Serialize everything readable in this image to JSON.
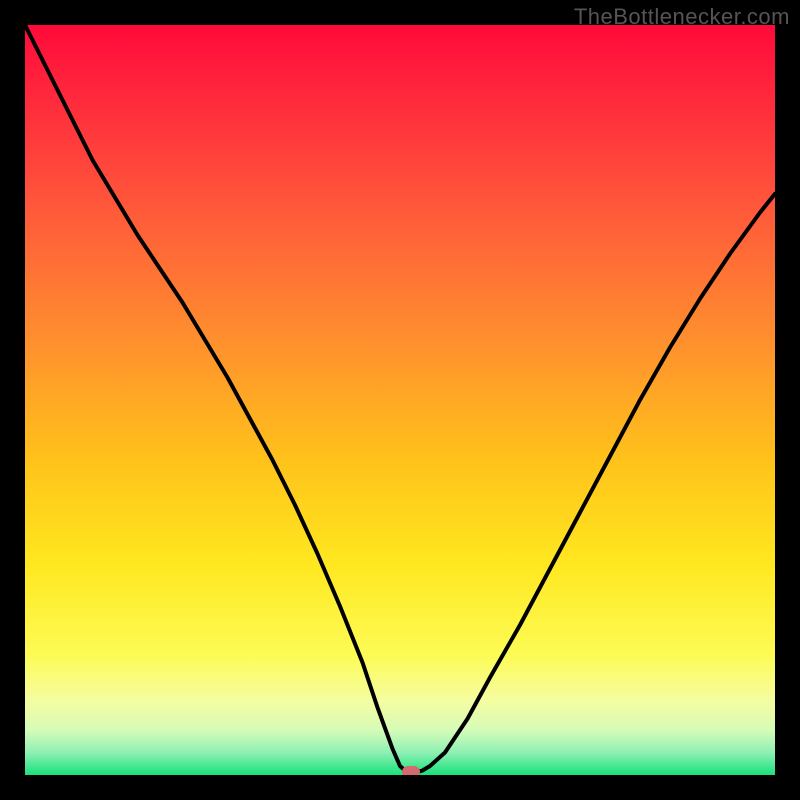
{
  "watermark": "TheBottlenecker.com",
  "chart_data": {
    "type": "line",
    "title": "",
    "xlabel": "",
    "ylabel": "",
    "xlim": [
      0,
      100
    ],
    "ylim": [
      0,
      100
    ],
    "x": [
      0,
      3,
      6,
      9,
      12,
      15,
      18,
      21,
      24,
      27,
      30,
      33,
      36,
      39,
      42,
      45,
      47,
      49,
      50,
      51,
      52,
      53,
      54,
      56,
      59,
      62,
      66,
      70,
      74,
      78,
      82,
      86,
      90,
      94,
      98,
      100
    ],
    "values": [
      100,
      94,
      88,
      82,
      77,
      72,
      67.5,
      63,
      58,
      53,
      47.5,
      42,
      36,
      29.5,
      22.5,
      15,
      9,
      3.5,
      1.2,
      0.3,
      0.3,
      0.6,
      1.2,
      3,
      7.5,
      13,
      20,
      27.5,
      35,
      42.5,
      50,
      57,
      63.5,
      69.5,
      75,
      77.5
    ],
    "marker": {
      "x": 51.5,
      "y": 0.4,
      "color": "#d46a6f"
    },
    "gradient_stops": [
      {
        "pct": 0,
        "color": "#ff0a3a"
      },
      {
        "pct": 10,
        "color": "#ff2a3c"
      },
      {
        "pct": 25,
        "color": "#ff5a3a"
      },
      {
        "pct": 42,
        "color": "#ff8f2e"
      },
      {
        "pct": 58,
        "color": "#ffc21a"
      },
      {
        "pct": 72,
        "color": "#ffe820"
      },
      {
        "pct": 84,
        "color": "#fdfb55"
      },
      {
        "pct": 90,
        "color": "#f5fda0"
      },
      {
        "pct": 94,
        "color": "#d6fcb8"
      },
      {
        "pct": 97,
        "color": "#8ef0b4"
      },
      {
        "pct": 100,
        "color": "#18e27a"
      }
    ]
  }
}
